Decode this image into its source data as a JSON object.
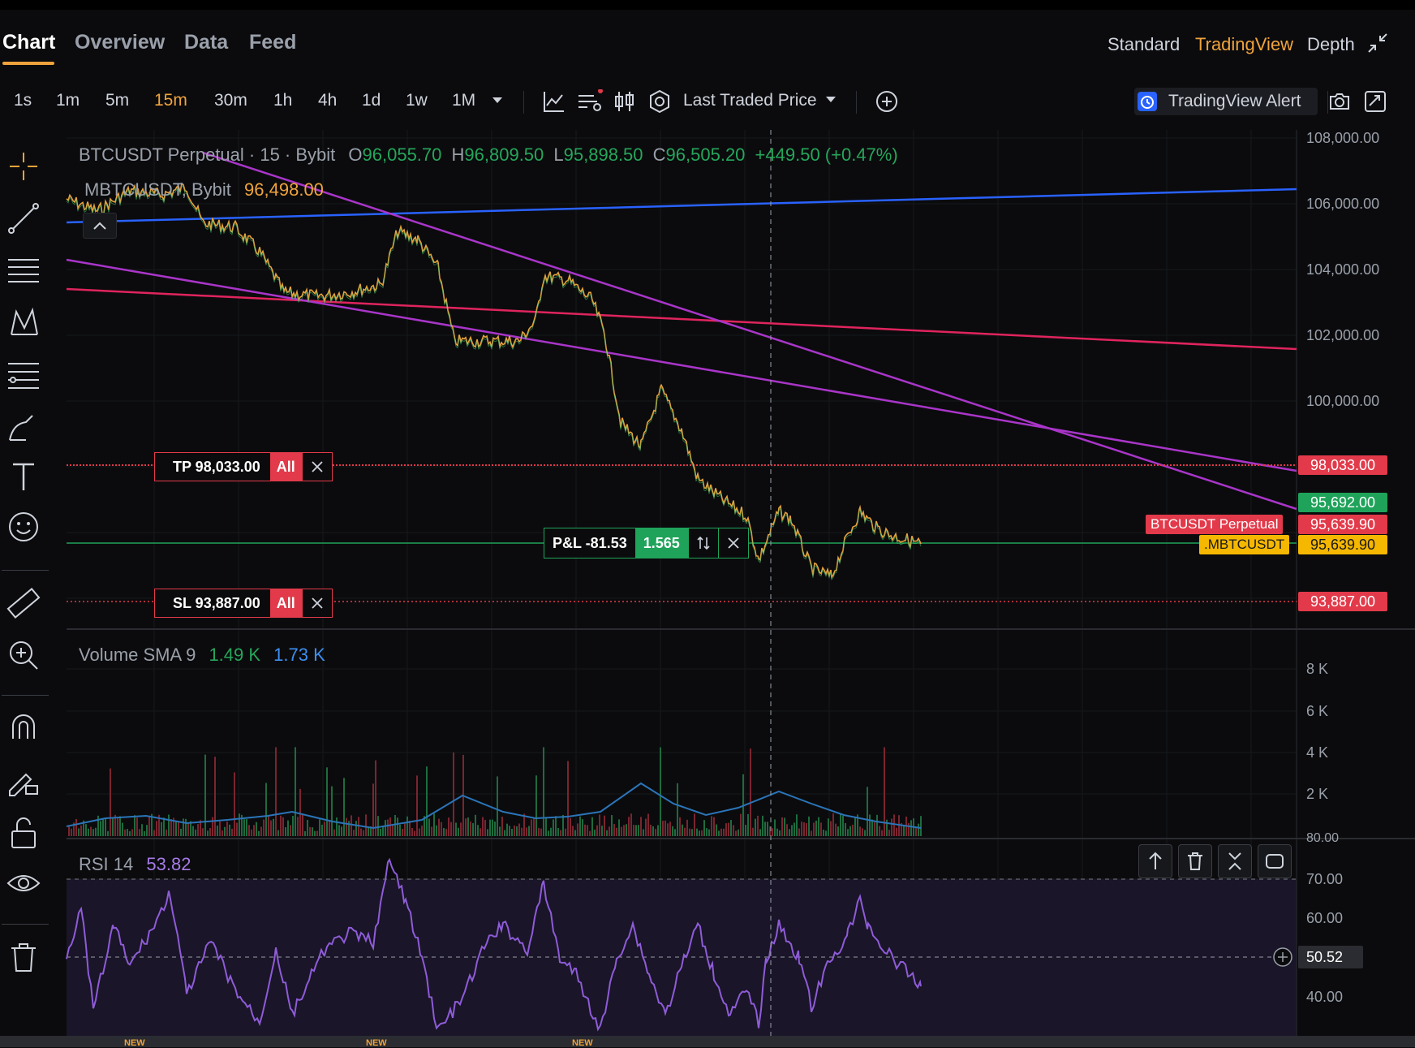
{
  "tabs": [
    {
      "label": "Chart",
      "active": true
    },
    {
      "label": "Overview",
      "active": false
    },
    {
      "label": "Data",
      "active": false
    },
    {
      "label": "Feed",
      "active": false
    }
  ],
  "view_modes": [
    {
      "label": "Standard",
      "active": false
    },
    {
      "label": "TradingView",
      "active": true
    },
    {
      "label": "Depth",
      "active": false
    }
  ],
  "timeframes": [
    {
      "label": "1s",
      "active": false
    },
    {
      "label": "1m",
      "active": false
    },
    {
      "label": "5m",
      "active": false
    },
    {
      "label": "15m",
      "active": true
    },
    {
      "label": "30m",
      "active": false
    },
    {
      "label": "1h",
      "active": false
    },
    {
      "label": "4h",
      "active": false
    },
    {
      "label": "1d",
      "active": false
    },
    {
      "label": "1w",
      "active": false
    },
    {
      "label": "1M",
      "active": false
    }
  ],
  "price_source": "Last Traded Price",
  "alert_button": "TradingView Alert",
  "legend": {
    "symbol": "BTCUSDT Perpetual · 15 · Bybit",
    "o_label": "O",
    "o": "96,055.70",
    "h_label": "H",
    "h": "96,809.50",
    "l_label": "L",
    "l": "95,898.50",
    "c_label": "C",
    "c": "96,505.20",
    "change": "+449.50 (+0.47%)",
    "second_symbol": "MBTCUSDT, Bybit",
    "second_value": "96,498.00"
  },
  "price_axis": [
    "108,000.00",
    "106,000.00",
    "104,000.00",
    "102,000.00",
    "100,000.00"
  ],
  "price_tags": {
    "tp": "98,033.00",
    "green": "95,692.00",
    "perp_label": "BTCUSDT Perpetual",
    "perp": "95,639.90",
    "mbtc_label": ".MBTCUSDT",
    "mbtc": "95,639.90",
    "sl": "93,887.00"
  },
  "orders": {
    "tp_label": "TP 98,033.00",
    "sl_label": "SL 93,887.00",
    "all": "All",
    "pnl_label": "P&L -81.53",
    "pnl_qty": "1.565"
  },
  "volume": {
    "title": "Volume SMA 9",
    "v1": "1.49 K",
    "v2": "1.73 K",
    "axis": [
      "8 K",
      "6 K",
      "4 K",
      "2 K"
    ]
  },
  "rsi": {
    "title": "RSI 14",
    "value": "53.82",
    "axis_top": "80.00",
    "axis": [
      "70.00",
      "60.00",
      "40.00"
    ],
    "crosshair_value": "50.52"
  },
  "markers": [
    "NEW",
    "NEW",
    "NEW"
  ],
  "colors": {
    "accent": "#f0a33c",
    "up": "#26a65b",
    "down": "#e23a4a",
    "trend_blue": "#2962ff",
    "trend_purple": "#a935c9",
    "trend_pink": "#e0245e",
    "rsi": "#8e5cd8"
  }
}
